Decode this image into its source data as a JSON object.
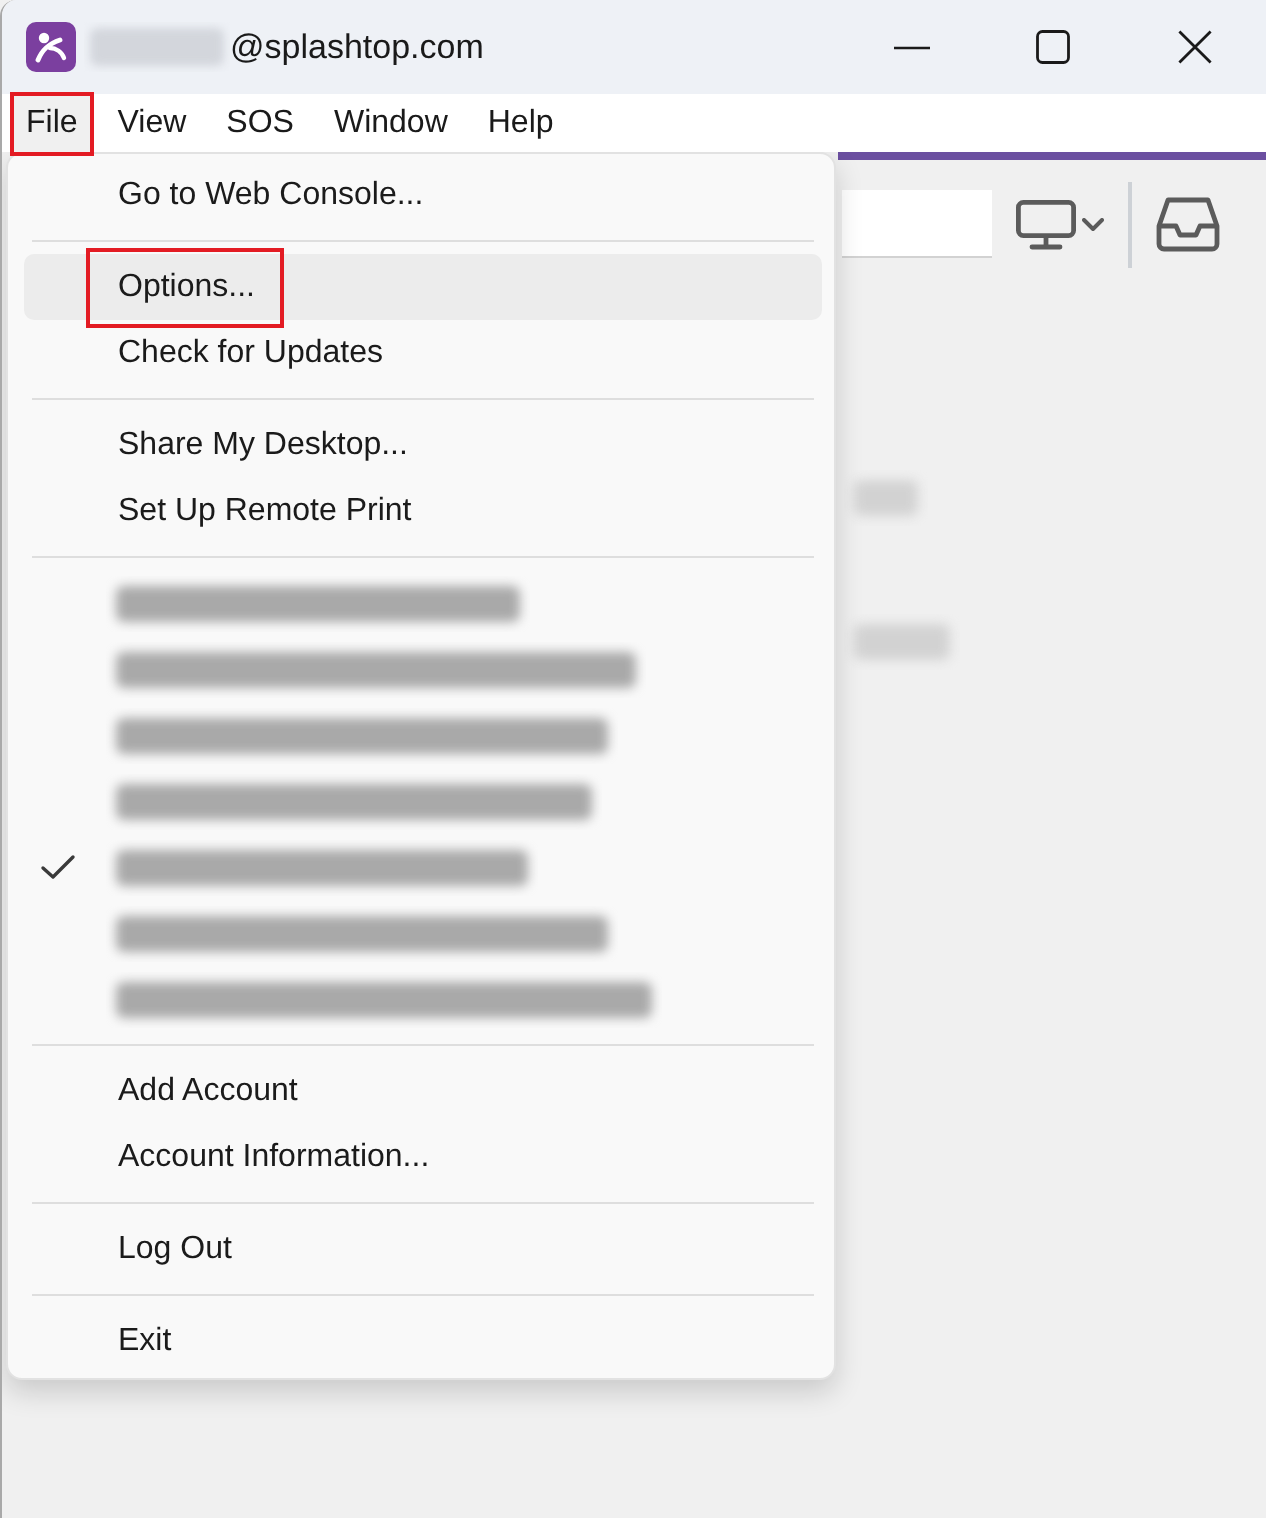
{
  "window": {
    "title": "@splashtop.com",
    "title_redacted": true
  },
  "menu_bar": [
    {
      "label": "File",
      "selected": true,
      "annotated": true
    },
    {
      "label": "View",
      "selected": false,
      "annotated": false
    },
    {
      "label": "SOS",
      "selected": false,
      "annotated": false
    },
    {
      "label": "Window",
      "selected": false,
      "annotated": false
    },
    {
      "label": "Help",
      "selected": false,
      "annotated": false
    }
  ],
  "file_menu": {
    "sections": [
      [
        {
          "kind": "command",
          "label": "Go to Web Console...",
          "checked": false,
          "hovered": false,
          "annotated": false
        }
      ],
      [
        {
          "kind": "command",
          "label": "Options...",
          "checked": false,
          "hovered": true,
          "annotated": true
        },
        {
          "kind": "command",
          "label": "Check for Updates",
          "checked": false,
          "hovered": false,
          "annotated": false
        }
      ],
      [
        {
          "kind": "command",
          "label": "Share My Desktop...",
          "checked": false,
          "hovered": false,
          "annotated": false
        },
        {
          "kind": "command",
          "label": "Set Up Remote Print",
          "checked": false,
          "hovered": false,
          "annotated": false
        }
      ],
      [
        {
          "kind": "account",
          "checked": false,
          "hovered": false,
          "annotated": false
        },
        {
          "kind": "account",
          "checked": false,
          "hovered": false,
          "annotated": false
        },
        {
          "kind": "account",
          "checked": false,
          "hovered": false,
          "annotated": false
        },
        {
          "kind": "account",
          "checked": false,
          "hovered": false,
          "annotated": false
        },
        {
          "kind": "account",
          "checked": true,
          "hovered": false,
          "annotated": false
        },
        {
          "kind": "account",
          "checked": false,
          "hovered": false,
          "annotated": false
        },
        {
          "kind": "account",
          "checked": false,
          "hovered": false,
          "annotated": false
        }
      ],
      [
        {
          "kind": "command",
          "label": "Add Account",
          "checked": false,
          "hovered": false,
          "annotated": false
        },
        {
          "kind": "command",
          "label": "Account Information...",
          "checked": false,
          "hovered": false,
          "annotated": false
        }
      ],
      [
        {
          "kind": "command",
          "label": "Log Out",
          "checked": false,
          "hovered": false,
          "annotated": false
        }
      ],
      [
        {
          "kind": "command",
          "label": "Exit",
          "checked": false,
          "hovered": false,
          "annotated": false
        }
      ]
    ]
  }
}
